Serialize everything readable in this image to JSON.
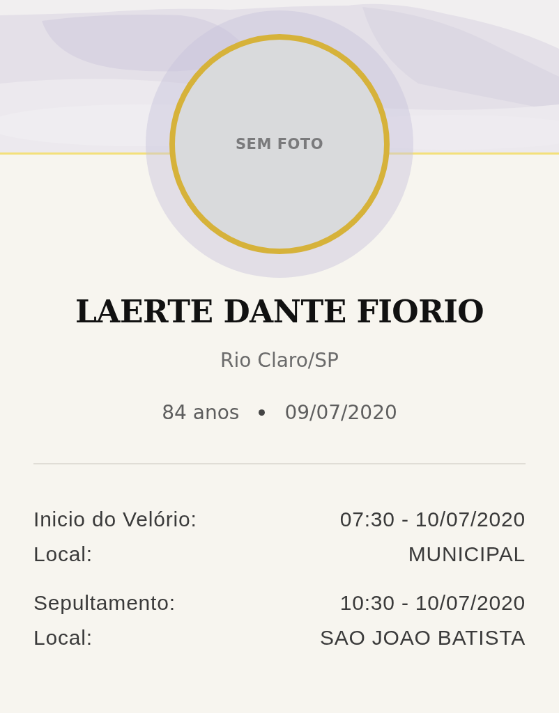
{
  "photo": {
    "caption": "SEM FOTO"
  },
  "name": "LAERTE DANTE FIORIO",
  "location": "Rio Claro/SP",
  "age": "84 anos",
  "date": "09/07/2020",
  "events": [
    {
      "rows": [
        {
          "label": "Inicio do Velório:",
          "value": "07:30 - 10/07/2020"
        },
        {
          "label": "Local:",
          "value": "MUNICIPAL"
        }
      ]
    },
    {
      "rows": [
        {
          "label": "Sepultamento:",
          "value": "10:30 - 10/07/2020"
        },
        {
          "label": "Local:",
          "value": "SAO JOAO BATISTA"
        }
      ]
    }
  ]
}
